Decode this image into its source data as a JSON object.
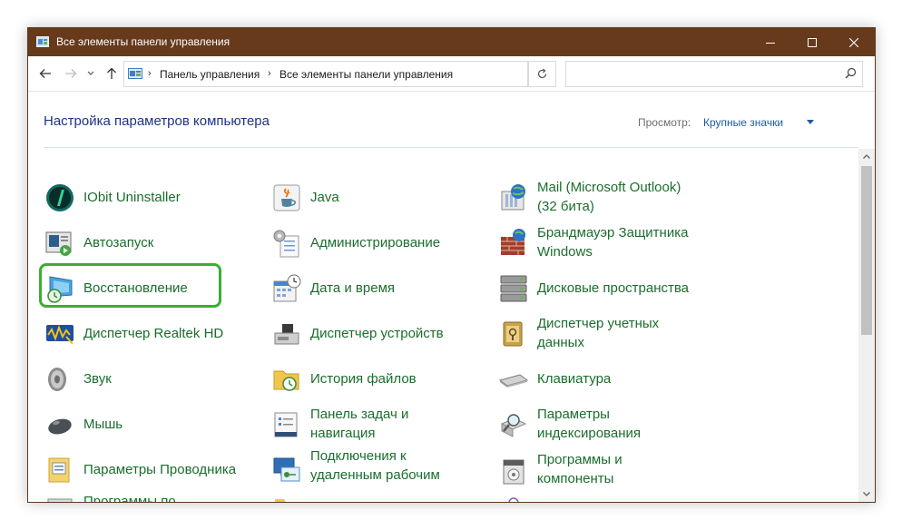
{
  "window": {
    "title": "Все элементы панели управления"
  },
  "address": {
    "crumbs": [
      "Панель управления",
      "Все элементы панели управления"
    ],
    "search_placeholder": ""
  },
  "header": {
    "title": "Настройка параметров компьютера",
    "view_label": "Просмотр:",
    "view_value": "Крупные значки"
  },
  "items": {
    "col1": [
      {
        "lines": [
          "IObit Uninstaller"
        ],
        "icon": "iobit-icon"
      },
      {
        "lines": [
          "Автозапуск"
        ],
        "icon": "autoplay-icon"
      },
      {
        "lines": [
          "Восстановление"
        ],
        "icon": "recovery-icon"
      },
      {
        "lines": [
          "Диспетчер Realtek HD"
        ],
        "icon": "realtek-icon"
      },
      {
        "lines": [
          "Звук"
        ],
        "icon": "speaker-icon"
      },
      {
        "lines": [
          "Мышь"
        ],
        "icon": "mouse-icon"
      },
      {
        "lines": [
          "Параметры Проводника"
        ],
        "icon": "folder-options-icon"
      },
      {
        "lines": [
          "Программы по"
        ],
        "icon": "default-programs-icon"
      }
    ],
    "col2": [
      {
        "lines": [
          "Java"
        ],
        "icon": "java-icon"
      },
      {
        "lines": [
          "Администрирование"
        ],
        "icon": "admin-tools-icon"
      },
      {
        "lines": [
          "Дата и время"
        ],
        "icon": "date-time-icon"
      },
      {
        "lines": [
          "Диспетчер устройств"
        ],
        "icon": "device-manager-icon"
      },
      {
        "lines": [
          "История файлов"
        ],
        "icon": "file-history-icon"
      },
      {
        "lines": [
          "Панель задач и",
          "навигация"
        ],
        "icon": "taskbar-icon"
      },
      {
        "lines": [
          "Подключения к",
          "удаленным рабочим"
        ],
        "icon": "remote-desktop-icon"
      },
      {
        "lines": [
          ""
        ],
        "icon": "folder-icon"
      }
    ],
    "col3": [
      {
        "lines": [
          "Mail (Microsoft Outlook)",
          "(32 бита)"
        ],
        "icon": "mail-icon"
      },
      {
        "lines": [
          "Брандмауэр Защитника",
          "Windows"
        ],
        "icon": "firewall-icon"
      },
      {
        "lines": [
          "Дисковые пространства"
        ],
        "icon": "storage-spaces-icon"
      },
      {
        "lines": [
          "Диспетчер учетных",
          "данных"
        ],
        "icon": "credential-manager-icon"
      },
      {
        "lines": [
          "Клавиатура"
        ],
        "icon": "keyboard-icon"
      },
      {
        "lines": [
          "Параметры",
          "индексирования"
        ],
        "icon": "indexing-icon"
      },
      {
        "lines": [
          "Программы и",
          "компоненты"
        ],
        "icon": "programs-features-icon"
      },
      {
        "lines": [
          ""
        ],
        "icon": "magnifier-icon"
      }
    ]
  },
  "colors": {
    "titlebar": "#673a1c",
    "item_text": "#1b6d2d",
    "header_text": "#1e3287",
    "link": "#1e5aa8",
    "highlight": "#3dad32"
  }
}
